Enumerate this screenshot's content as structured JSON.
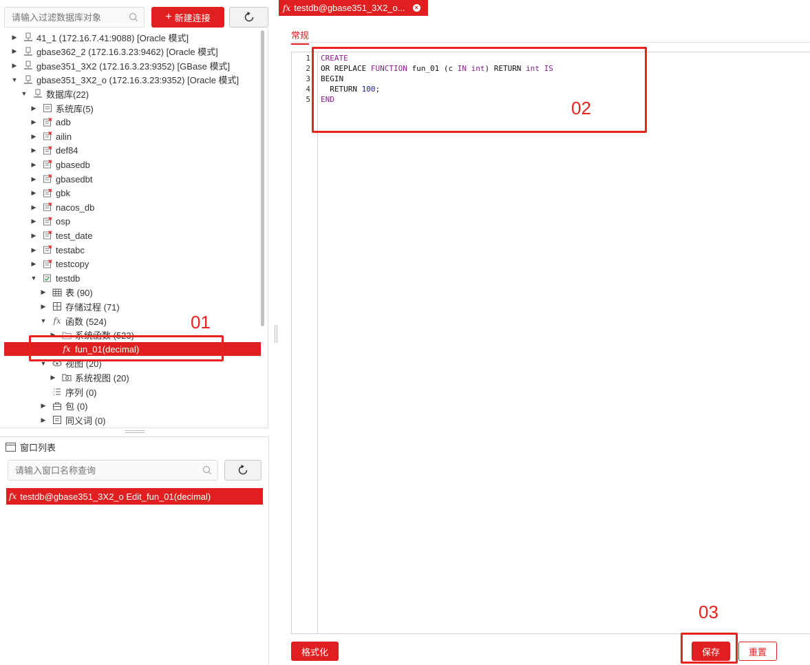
{
  "toolbar": {
    "filter_placeholder": "请输入过滤数据库对象",
    "new_connection_label": "新建连接",
    "icons": {
      "search": "search-icon",
      "plus": "plus-icon",
      "refresh": "refresh-icon"
    }
  },
  "tree": {
    "connections": [
      {
        "label": "41_1 (172.16.7.41:9088) [Oracle 模式]",
        "expanded": false
      },
      {
        "label": "gbase362_2 (172.16.3.23:9462) [Oracle 模式]",
        "expanded": false
      },
      {
        "label": "gbase351_3X2 (172.16.3.23:9352) [GBase 模式]",
        "expanded": false
      },
      {
        "label": "gbase351_3X2_o (172.16.3.23:9352) [Oracle 模式]",
        "expanded": true
      }
    ],
    "db_folder": "数据库(22)",
    "system_db": "系统库(5)",
    "databases": [
      "adb",
      "ailin",
      "def84",
      "gbasedb",
      "gbasedbt",
      "gbk",
      "nacos_db",
      "osp",
      "test_date",
      "testabc",
      "testcopy"
    ],
    "open_db": "testdb",
    "tables": "表 (90)",
    "procedures": "存储过程 (71)",
    "functions": "函数 (524)",
    "system_functions": "系统函数 (523)",
    "selected_function": "fun_01(decimal)",
    "views": "视图 (20)",
    "system_views": "系统视图 (20)",
    "sequences": "序列 (0)",
    "packages": "包 (0)",
    "synonyms": "同义词 (0)"
  },
  "window_list": {
    "title": "窗口列表",
    "search_placeholder": "请输入窗口名称查询",
    "items": [
      "testdb@gbase351_3X2_o Edit_fun_01(decimal)"
    ]
  },
  "editor_tab": {
    "title": "testdb@gbase351_3X2_o...",
    "sub_tab": "常规"
  },
  "code": {
    "line_numbers": [
      "1",
      "2",
      "3",
      "4",
      "5"
    ],
    "lines": [
      [
        {
          "t": "CREATE",
          "c": "kw"
        }
      ],
      [
        {
          "t": "OR REPLACE ",
          "c": ""
        },
        {
          "t": "FUNCTION",
          "c": "kw"
        },
        {
          "t": " fun_01 (c ",
          "c": ""
        },
        {
          "t": "IN",
          "c": "kw"
        },
        {
          "t": " ",
          "c": ""
        },
        {
          "t": "int",
          "c": "kw"
        },
        {
          "t": ") RETURN ",
          "c": ""
        },
        {
          "t": "int",
          "c": "kw"
        },
        {
          "t": " ",
          "c": ""
        },
        {
          "t": "IS",
          "c": "kw"
        }
      ],
      [
        {
          "t": "BEGIN",
          "c": ""
        }
      ],
      [
        {
          "t": "  RETURN ",
          "c": ""
        },
        {
          "t": "100",
          "c": "num"
        },
        {
          "t": ";",
          "c": ""
        }
      ],
      [
        {
          "t": "END",
          "c": "kw"
        }
      ]
    ]
  },
  "buttons": {
    "format": "格式化",
    "save": "保存",
    "reset": "重置"
  },
  "annotations": {
    "a1": "01",
    "a2": "02",
    "a3": "03"
  },
  "colors": {
    "accent": "#e02020",
    "annotation": "#e8231f",
    "keyword": "#8b1d8b",
    "number": "#1a1aa6"
  }
}
